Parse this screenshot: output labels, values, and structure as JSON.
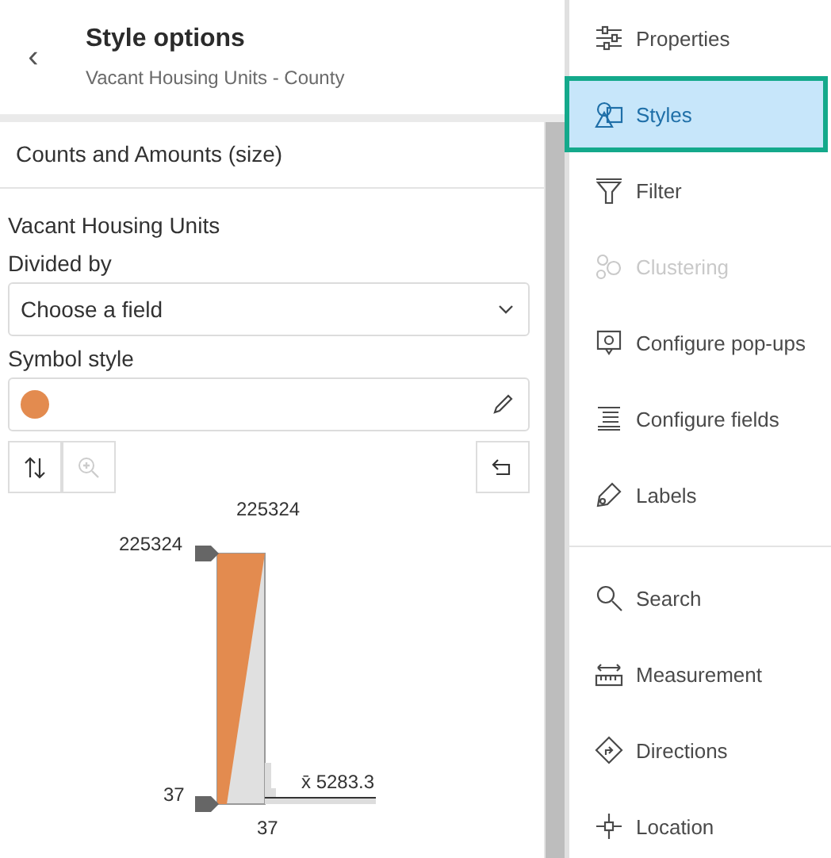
{
  "panel": {
    "back_icon": "‹",
    "title": "Style options",
    "subtitle": "Vacant Housing Units - County"
  },
  "section": {
    "title": "Counts and Amounts (size)"
  },
  "field_name": "Vacant Housing Units",
  "divided_by": {
    "label": "Divided by",
    "value": "Choose a field"
  },
  "symbol_style": {
    "label": "Symbol style",
    "color": "#e38b4f"
  },
  "histogram": {
    "top_label": "225324",
    "bottom_label": "37",
    "handle_max": "225324",
    "handle_min": "37",
    "average": "x̄ 5283.3"
  },
  "tools": [
    [
      {
        "kind": "properties",
        "label": "Properties",
        "selected": false,
        "disabled": false
      },
      {
        "kind": "styles",
        "label": "Styles",
        "selected": true,
        "disabled": false
      },
      {
        "kind": "filter",
        "label": "Filter",
        "selected": false,
        "disabled": false
      },
      {
        "kind": "clustering",
        "label": "Clustering",
        "selected": false,
        "disabled": true
      },
      {
        "kind": "popups",
        "label": "Configure pop-ups",
        "selected": false,
        "disabled": false
      },
      {
        "kind": "fields",
        "label": "Configure fields",
        "selected": false,
        "disabled": false
      },
      {
        "kind": "labels",
        "label": "Labels",
        "selected": false,
        "disabled": false
      }
    ],
    [
      {
        "kind": "search",
        "label": "Search",
        "selected": false,
        "disabled": false
      },
      {
        "kind": "measurement",
        "label": "Measurement",
        "selected": false,
        "disabled": false
      },
      {
        "kind": "directions",
        "label": "Directions",
        "selected": false,
        "disabled": false
      },
      {
        "kind": "location",
        "label": "Location",
        "selected": false,
        "disabled": false
      }
    ]
  ]
}
